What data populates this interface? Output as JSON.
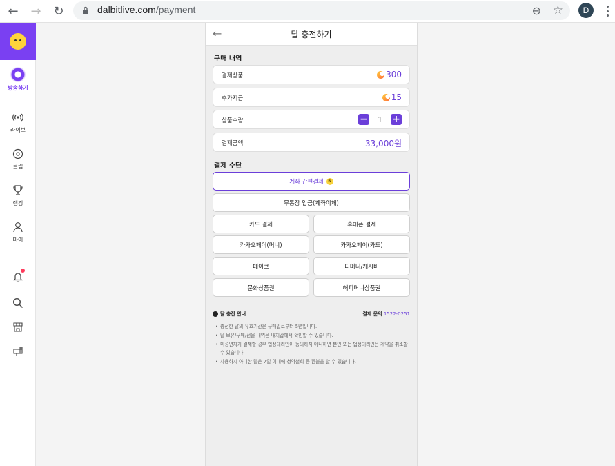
{
  "browser": {
    "url_host": "dalbitlive.com",
    "url_path": "/payment",
    "profile_initial": "D"
  },
  "sidebar": {
    "broadcast_label": "방송하기",
    "items": [
      {
        "label": "라이브",
        "icon": "live-radio-icon"
      },
      {
        "label": "클립",
        "icon": "clip-disc-icon"
      },
      {
        "label": "랭킹",
        "icon": "trophy-icon"
      },
      {
        "label": "마이",
        "icon": "user-icon"
      }
    ],
    "bottom_icons": [
      "bell-icon",
      "search-icon",
      "store-icon",
      "mailbox-icon"
    ]
  },
  "page": {
    "title": "달 충전하기",
    "purchase_section": "구매 내역",
    "rows": [
      {
        "label": "결제상품",
        "value": "300"
      },
      {
        "label": "추가지급",
        "value": "15"
      },
      {
        "label": "상품수량",
        "value": "1"
      },
      {
        "label": "결제금액",
        "value": "33,000원"
      }
    ],
    "payment_section": "결제 수단",
    "methods": {
      "easy": "계좌 간편결제",
      "easy_badge": "N",
      "bank": "무통장 입금(계좌이체)",
      "card": "카드 결제",
      "phone": "휴대폰 결제",
      "kakao_money": "카카오페이(머니)",
      "kakao_card": "카카오페이(카드)",
      "payco": "페이코",
      "tmoney": "티머니/캐시비",
      "culture": "문화상품권",
      "happy": "해피머니상품권"
    },
    "notice_title": "달 충전 안내",
    "inquiry_label": "결제 문의",
    "inquiry_phone": "1522-0251",
    "notices": [
      "충전한 달의 유효기간은 구매일로부터 5년입니다.",
      "달 보유/구매/선물 내역은 내지갑에서 확인할 수 있습니다.",
      "미성년자가 결제할 경우 법정대리인이 동의하지 아니하면 본인 또는 법정대리인은 계약을 취소할 수 있습니다.",
      "사용하지 아니한 달은 7일 이내에 청약철회 등 환불을 할 수 있습니다."
    ]
  },
  "colors": {
    "accent": "#6b3fd9",
    "logo_bg": "#7a40f2"
  }
}
